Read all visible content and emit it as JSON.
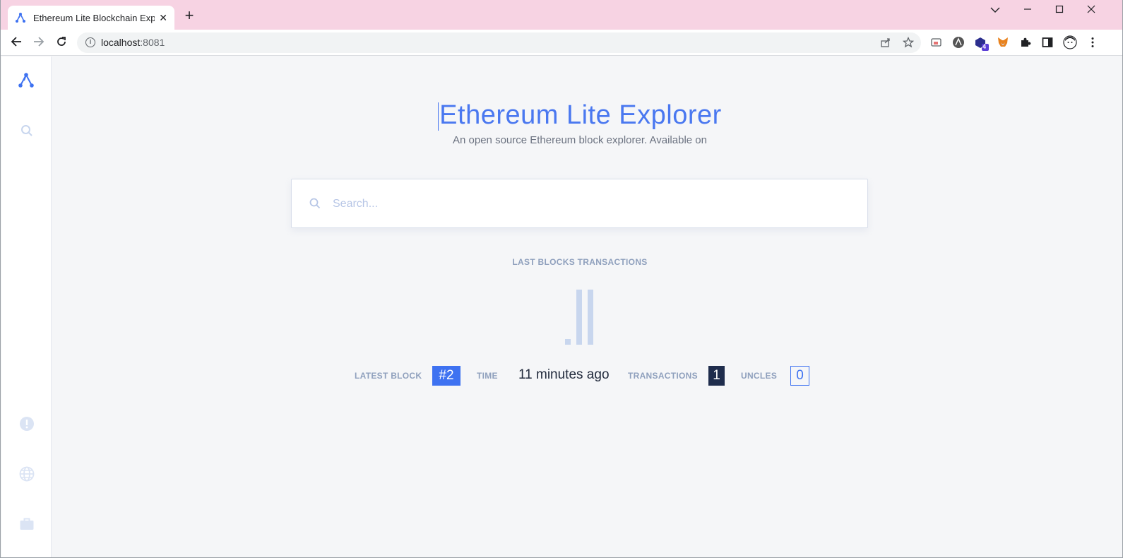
{
  "browser": {
    "tab_title": "Ethereum Lite Blockchain Explor",
    "new_tab": "+",
    "url_host": "localhost",
    "url_port": ":8081",
    "window_controls": {
      "chevron": "⌄",
      "minimize": "—",
      "maximize": "☐",
      "close": "✕"
    },
    "extension_badge": "4"
  },
  "sidebar": {
    "items": [
      {
        "icon": "logo-icon"
      },
      {
        "icon": "search-icon"
      },
      {
        "icon": "info-icon"
      },
      {
        "icon": "globe-icon"
      },
      {
        "icon": "briefcase-icon"
      }
    ]
  },
  "hero": {
    "title": "Ethereum Lite Explorer",
    "subtitle": "An open source Ethereum block explorer. Available on"
  },
  "search": {
    "placeholder": "Search..."
  },
  "latest": {
    "section_label": "LAST BLOCKS TRANSACTIONS",
    "latest_block_label": "LATEST BLOCK",
    "latest_block_value": "#2",
    "time_label": "TIME",
    "time_value": "11 minutes ago",
    "transactions_label": "TRANSACTIONS",
    "transactions_value": "1",
    "uncles_label": "UNCLES",
    "uncles_value": "0"
  },
  "colors": {
    "accent": "#3e72f1",
    "title": "#4a78f0",
    "dark_badge": "#1f2d4d",
    "muted_label": "#8fa0bd",
    "chrome_titlebar": "#f7d3e3",
    "placeholder": "#b7c6e6",
    "bars": "#c8d6ee"
  }
}
